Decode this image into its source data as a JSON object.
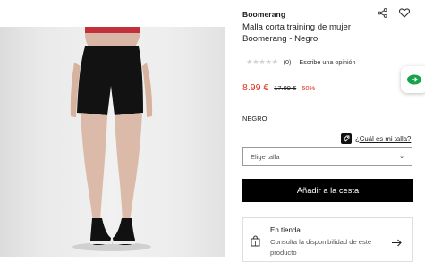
{
  "product": {
    "brand": "Boomerang",
    "title": "Malla corta training de mujer Boomerang - Negro",
    "rating_stars": "★★★★★",
    "rating_count": "(0)",
    "review_link": "Escribe una opinión",
    "price": "8.99 €",
    "old_price": "17.99 €",
    "discount": "50%",
    "color_label": "NEGRO",
    "size_guide": "¿Cuál es mi talla?",
    "size_select_placeholder": "Elige talla",
    "add_to_cart": "Añadir a la cesta"
  },
  "store": {
    "title": "En tienda",
    "subtitle": "Consulta la disponibilidad de este producto"
  },
  "colors": {
    "sale": "#e0301e",
    "button_bg": "#000000",
    "fab_green": "#17a34a"
  },
  "icons": [
    "share-icon",
    "heart-icon",
    "tag-icon",
    "chevron-down-icon",
    "store-icon",
    "arrow-right-icon",
    "chat-icon"
  ]
}
